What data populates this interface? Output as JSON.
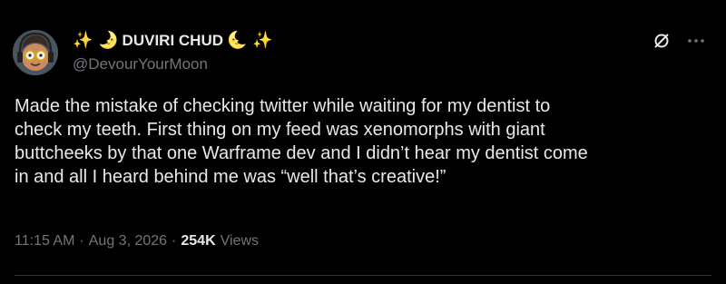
{
  "author": {
    "display_name": "DUVIRI CHUD",
    "name_prefix_emoji": "✨ 🌛",
    "name_suffix_emoji": "🌜 ✨",
    "handle": "@DevourYourMoon",
    "avatar_icon": "avatar-cartoon-glasses-headphones"
  },
  "actions": {
    "grok_icon": "slashed-circle-icon",
    "more_label": "···"
  },
  "tweet": {
    "text_lines": [
      "Made the mistake of checking twitter while waiting for my dentist to",
      "check my teeth. First thing on my feed was xenomorphs with giant",
      "buttcheeks by that one Warframe dev and I didn’t hear my dentist come",
      "in and all I heard behind me was “well that’s creative!”"
    ]
  },
  "meta": {
    "time": "11:15 AM",
    "separator": "·",
    "date": "Aug 3, 2026",
    "views_count": "254K",
    "views_label": "Views"
  },
  "colors": {
    "background": "#000000",
    "text_primary": "#e7e9ea",
    "text_secondary": "#71767b",
    "divider": "#2f3336"
  }
}
